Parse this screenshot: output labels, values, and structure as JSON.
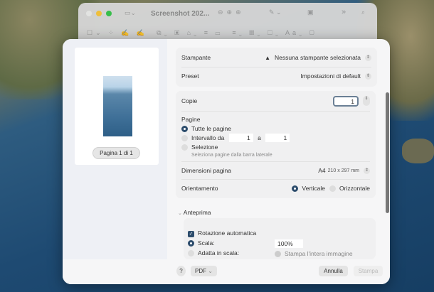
{
  "window": {
    "title": "Screenshot 202..."
  },
  "preview": {
    "page_label": "Pagina 1 di 1"
  },
  "printer": {
    "label": "Stampante",
    "value": "Nessuna stampante selezionata"
  },
  "preset": {
    "label": "Preset",
    "value": "Impostazioni di default"
  },
  "copies": {
    "label": "Copie",
    "value": "1"
  },
  "pages": {
    "label": "Pagine",
    "all": "Tutte le pagine",
    "range": "Intervallo da",
    "range_from": "1",
    "range_sep": "a",
    "range_to": "1",
    "selection": "Selezione",
    "selection_hint": "Seleziona pagine dalla barra laterale"
  },
  "page_size": {
    "label": "Dimensioni pagina",
    "value": "A4",
    "dims": "210 x 297 mm"
  },
  "orientation": {
    "label": "Orientamento",
    "portrait": "Verticale",
    "landscape": "Orizzontale"
  },
  "preview_section": {
    "label": "Anteprima",
    "auto_rotate": "Rotazione automatica",
    "scale": "Scala:",
    "scale_value": "100%",
    "fit": "Adatta in scala:",
    "fit_option": "Stampa l'intera immagine"
  },
  "footer": {
    "help": "?",
    "pdf": "PDF",
    "cancel": "Annulla",
    "print": "Stampa"
  }
}
